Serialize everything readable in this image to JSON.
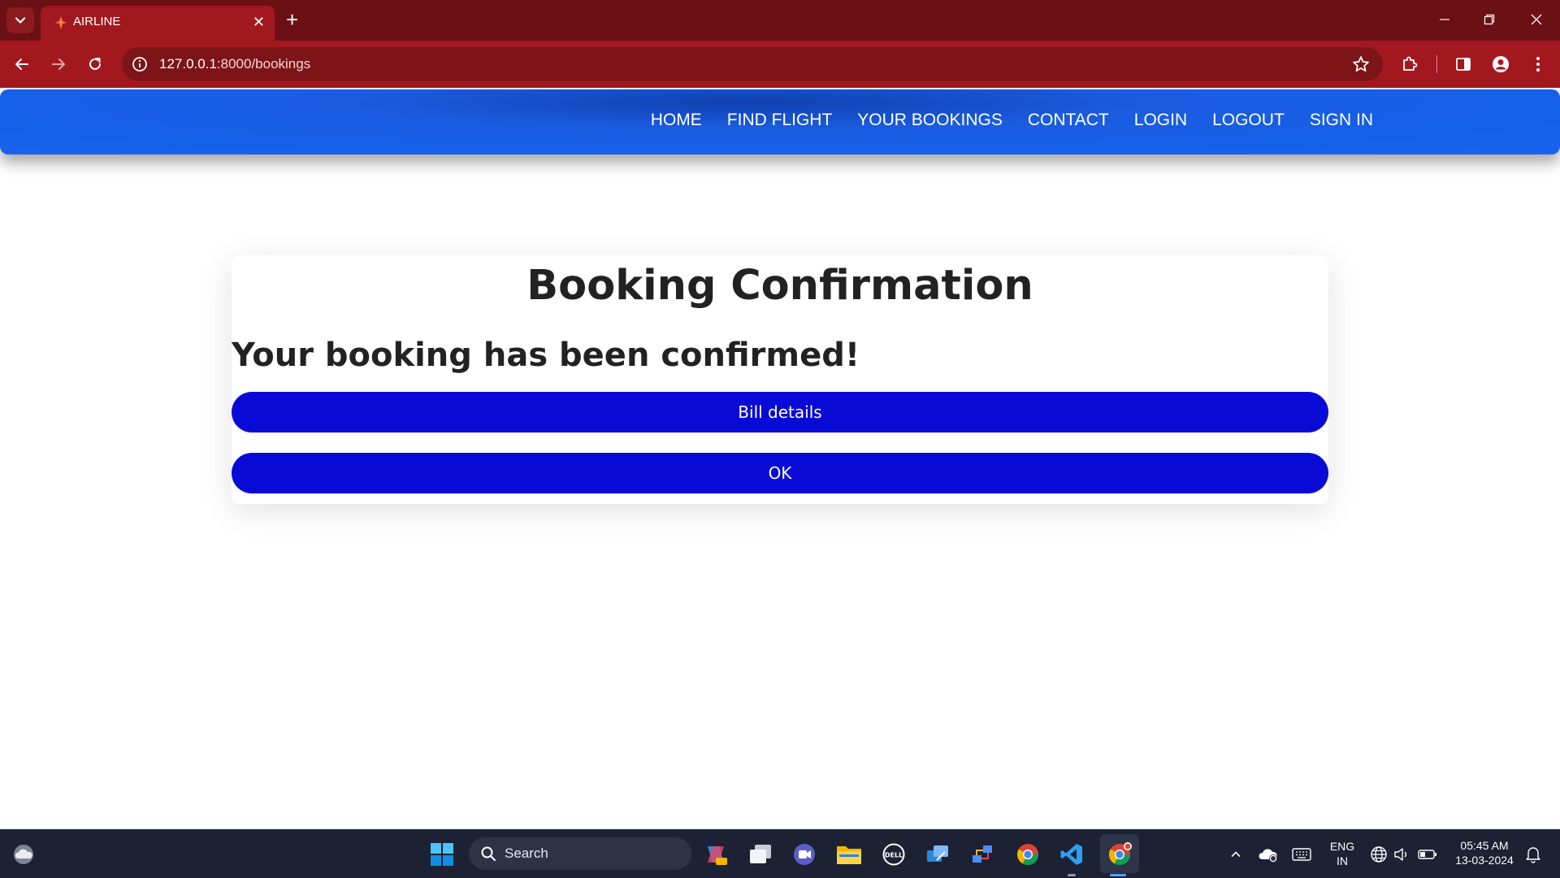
{
  "browser": {
    "tab_title": "AIRLINE",
    "tab_close": "✕",
    "new_tab": "+",
    "url_host": "127.0.0.1",
    "url_rest": ":8000/bookings"
  },
  "nav": {
    "links": [
      "HOME",
      "FIND FLIGHT",
      "YOUR BOOKINGS",
      "CONTACT",
      "LOGIN",
      "LOGOUT",
      "SIGN IN"
    ]
  },
  "confirmation": {
    "title": "Booking Confirmation",
    "message": "Your booking has been confirmed!",
    "bill_button": "Bill details",
    "ok_button": "OK"
  },
  "taskbar": {
    "search_placeholder": "Search",
    "language": "ENG",
    "region": "IN",
    "time": "05:45 AM",
    "date": "13-03-2024"
  },
  "colors": {
    "tab_strip": "#6b1014",
    "toolbar": "#a3181f",
    "navbar": "#1a5ce0",
    "button": "#0a0ad6",
    "taskbar": "#1c2133"
  }
}
